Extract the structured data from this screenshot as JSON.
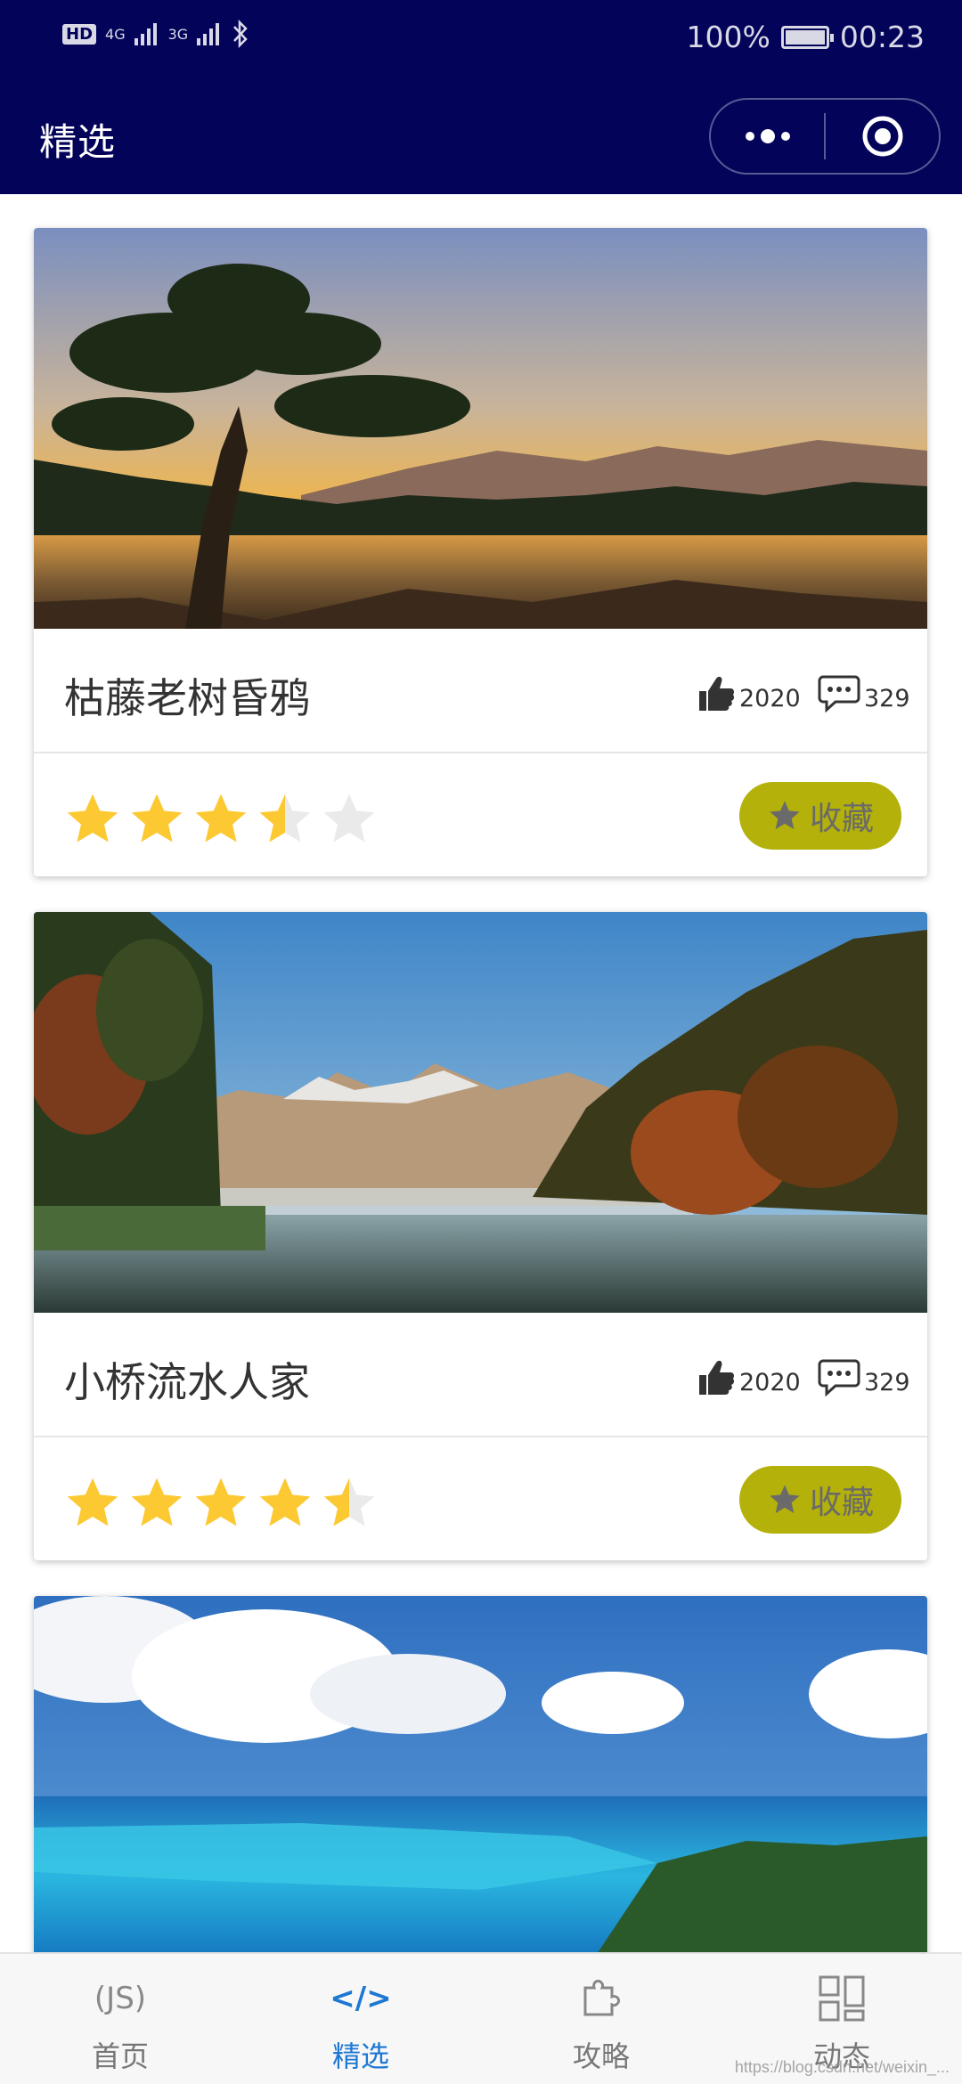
{
  "status_bar": {
    "network_left": "HD",
    "signal_1": "4G",
    "signal_2": "3G",
    "battery": "100%",
    "time": "00:23"
  },
  "nav": {
    "title": "精选"
  },
  "cards": [
    {
      "title": "枯藤老树昏鸦",
      "likes": "2020",
      "comments": "329",
      "rating": 3.5,
      "fav_label": "收藏"
    },
    {
      "title": "小桥流水人家",
      "likes": "2020",
      "comments": "329",
      "rating": 4.5,
      "fav_label": "收藏"
    },
    {
      "title": "",
      "rating": null
    }
  ],
  "tabbar": {
    "items": [
      {
        "label": "首页",
        "icon": "(JS)"
      },
      {
        "label": "精选",
        "icon": "</>"
      },
      {
        "label": "攻略",
        "icon": "puzzle-icon"
      },
      {
        "label": "动态",
        "icon": "grid-icon"
      }
    ],
    "active_index": 1
  },
  "colors": {
    "header_bg": "#03035a",
    "accent": "#1e78d2",
    "fav_bg": "#b3b10a",
    "star": "#fcc933",
    "star_empty": "#eaeaea"
  },
  "watermark": "https://blog.csdn.net/weixin_..."
}
